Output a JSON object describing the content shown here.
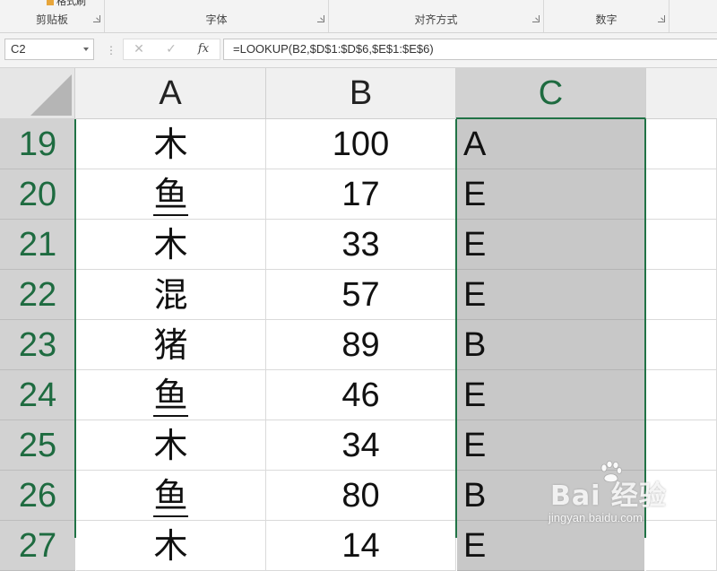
{
  "ribbon": {
    "groups": [
      {
        "label": "剪贴板"
      },
      {
        "label": "字体"
      },
      {
        "label": "对齐方式"
      },
      {
        "label": "数字"
      }
    ],
    "partial_button_label": "格式刷"
  },
  "formula_bar": {
    "name_box": "C2",
    "cancel_icon": "close-icon",
    "enter_icon": "check-icon",
    "fx_label": "fx",
    "formula": "=LOOKUP(B2,$D$1:$D$6,$E$1:$E$6)"
  },
  "sheet": {
    "columns": [
      "A",
      "B",
      "C"
    ],
    "selected_column": "C",
    "rows": [
      {
        "num": "19",
        "a": "木",
        "b": "100",
        "c": "A"
      },
      {
        "num": "20",
        "a": "鱼",
        "b": "17",
        "c": "E"
      },
      {
        "num": "21",
        "a": "木",
        "b": "33",
        "c": "E"
      },
      {
        "num": "22",
        "a": "混",
        "b": "57",
        "c": "E"
      },
      {
        "num": "23",
        "a": "猪",
        "b": "89",
        "c": "B"
      },
      {
        "num": "24",
        "a": "鱼",
        "b": "46",
        "c": "E"
      },
      {
        "num": "25",
        "a": "木",
        "b": "34",
        "c": "E"
      },
      {
        "num": "26",
        "a": "鱼",
        "b": "80",
        "c": "B"
      },
      {
        "num": "27",
        "a": "木",
        "b": "14",
        "c": "E"
      }
    ]
  },
  "watermark": {
    "main": "Bai 经验",
    "sub": "jingyan.baidu.com"
  },
  "colors": {
    "accent_green": "#217346",
    "selection_gray": "#c8c8c8"
  }
}
